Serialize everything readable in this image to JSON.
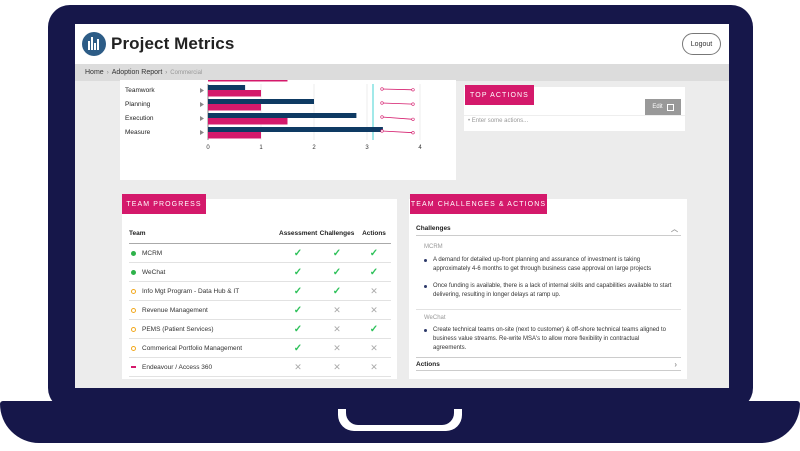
{
  "app": {
    "title": "Project Metrics",
    "logout_label": "Logout"
  },
  "breadcrumb": {
    "home": "Home",
    "sep": "›",
    "report": "Adoption Report",
    "current": "Commercial"
  },
  "colors": {
    "accent": "#d4196b",
    "navy": "#0e3a63",
    "frame": "#16174a",
    "check": "#2ec15a"
  },
  "chart_data": {
    "type": "bar",
    "orientation": "horizontal",
    "categories": [
      "Teamwork",
      "Planning",
      "Execution",
      "Measure"
    ],
    "series": [
      {
        "values": [
          0.7,
          2.0,
          2.8,
          3.3
        ],
        "color": "#0e3a63"
      },
      {
        "values": [
          1.0,
          1.0,
          1.5,
          1.0
        ],
        "color": "#d4196b"
      }
    ],
    "xlim": [
      0,
      4
    ],
    "ticks": [
      "0",
      "1",
      "2",
      "3",
      "4"
    ]
  },
  "top_actions": {
    "title": "TOP ACTIONS",
    "edit_label": "Edit",
    "placeholder": "• Enter some actions..."
  },
  "team_progress": {
    "title": "TEAM PROGRESS",
    "columns": [
      "Team",
      "Assessment",
      "Challenges",
      "Actions"
    ],
    "rows": [
      {
        "name": "MCRM",
        "status": "green",
        "assessment": "✓",
        "challenges": "✓",
        "actions": "✓"
      },
      {
        "name": "WeChat",
        "status": "green",
        "assessment": "✓",
        "challenges": "✓",
        "actions": "✓"
      },
      {
        "name": "Info Mgt Program - Data Hub & IT",
        "status": "amber",
        "assessment": "✓",
        "challenges": "✓",
        "actions": "✕"
      },
      {
        "name": "Revenue Management",
        "status": "amber",
        "assessment": "✓",
        "challenges": "✕",
        "actions": "✕"
      },
      {
        "name": "PEMS (Patient Services)",
        "status": "amber",
        "assessment": "✓",
        "challenges": "✕",
        "actions": "✓"
      },
      {
        "name": "Commerical Portfolio Management",
        "status": "amber",
        "assessment": "✓",
        "challenges": "✕",
        "actions": "✕"
      },
      {
        "name": "Endeavour / Access 360",
        "status": "none",
        "assessment": "✕",
        "challenges": "✕",
        "actions": "✕"
      }
    ]
  },
  "challenges": {
    "title": "TEAM CHALLENGES & ACTIONS",
    "section_label": "Challenges",
    "teams": [
      {
        "name": "MCRM",
        "bullets": [
          "A demand for detailed up-front planning and assurance of investment is taking approximately 4-6 months to get through business case approval on large projects",
          "Once funding is available, there is a lack of internal skills and capabilities available to start delivering, resulting in longer delays at ramp up."
        ]
      },
      {
        "name": "WeChat",
        "bullets": [
          "Create technical teams on-site (next to customer) & off-shore technical teams aligned to business value streams. Re-write MSA's to allow more flexibility in contractual agreements."
        ]
      }
    ],
    "actions_label": "Actions"
  }
}
